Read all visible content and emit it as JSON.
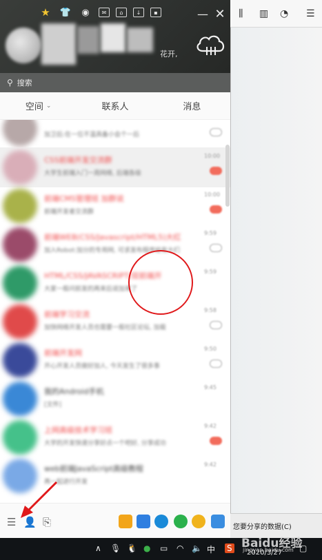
{
  "qq": {
    "search_placeholder": "搜索",
    "signature_fragment": "花开,",
    "tabs": [
      {
        "label": "空间",
        "has_dropdown": true
      },
      {
        "label": "联系人",
        "has_dropdown": false
      },
      {
        "label": "消息",
        "has_dropdown": false
      }
    ],
    "active_tab": "消息",
    "conversations": [
      {
        "name": "",
        "preview": "加卫后:在一位不温具备小会个一后",
        "time": "",
        "badge": "gray",
        "avatar_color": "#b7a8a8"
      },
      {
        "name": "CSS前端开发交流群",
        "preview": "大学生前端入门一周网络, 后端各级",
        "time": "10:00",
        "badge": "red",
        "avatar_color": "#d9aeb8",
        "selected": true
      },
      {
        "name": "前端CMS管理班 加群说",
        "preview": "前端开发者交流群",
        "time": "10:00",
        "badge": "red",
        "avatar_color": "#a9b24a"
      },
      {
        "name": "前端WEB(CSS/Javascript/HTML5)大红",
        "preview": "加入Robot:加分的专用网, 可求发布程序给有大们",
        "time": "9:59",
        "badge": "gray",
        "avatar_color": "#9b4b6a"
      },
      {
        "name": "HTML/CSS/JAVASCRIPT/双前端开",
        "preview": "大家一般问前发的再来后说加来了",
        "time": "9:59",
        "badge": "",
        "avatar_color": "#2f9a68"
      },
      {
        "name": "前端学习交流",
        "preview": "加快网络开发人员也需要一般社区论坛, 加载",
        "time": "9:58",
        "badge": "gray",
        "avatar_color": "#e04a4a"
      },
      {
        "name": "前端开发网",
        "preview": "开心开发人员做好加人, 今天发生了很多事",
        "time": "9:50",
        "badge": "gray",
        "avatar_color": "#3a4a9a"
      },
      {
        "name": "我的Android手机",
        "preview": "[文件]",
        "time": "9:45",
        "badge": "",
        "avatar_color": "#3a88d6",
        "name_black": true
      },
      {
        "name": "上网高级技术学习班",
        "preview": "大学的开发快速分享好点一个吧好, 分享成功",
        "time": "9:42",
        "badge": "red",
        "avatar_color": "#45c18a"
      },
      {
        "name": "web前端JavaScript高级教程",
        "preview": "再一起进行开发",
        "time": "9:42",
        "badge": "",
        "avatar_color": "#7aa9e6",
        "name_black": true
      }
    ]
  },
  "browser": {
    "share_text": "您要分享的数据(C)"
  },
  "taskbar": {
    "ime_label": "中",
    "date": "2020/3/27"
  },
  "watermark": {
    "main": "Baidu经验",
    "sub": "jingyan.baidu.com"
  },
  "colors": {
    "accent_red": "#e0191b",
    "header_dark": "#2f3230",
    "search_bar": "#5b5d5c"
  }
}
